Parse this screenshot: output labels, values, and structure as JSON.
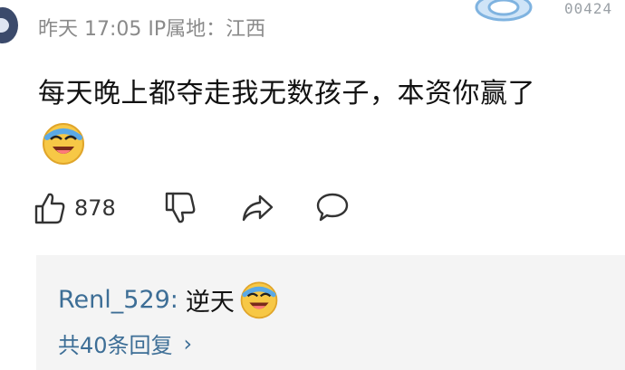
{
  "comment": {
    "meta": "昨天 17:05 IP属地：江西",
    "text": "每天晚上都夺走我无数孩子，本资你赢了",
    "emoji": "laughing-crying-emoji"
  },
  "header": {
    "counter": "00424"
  },
  "actions": {
    "like_count": "878",
    "icons": [
      "thumbs-up-icon",
      "thumbs-down-icon",
      "share-icon",
      "comment-icon"
    ]
  },
  "reply": {
    "username": "Renl_529:",
    "text": "逆天",
    "emoji": "laughing-crying-emoji",
    "more_label": "共40条回复",
    "more_chevron": "›"
  },
  "colors": {
    "meta_gray": "#8a8a8a",
    "link_blue": "#3d6e96",
    "reply_bg": "#f4f4f4",
    "emoji_yellow": "#f7c846"
  }
}
